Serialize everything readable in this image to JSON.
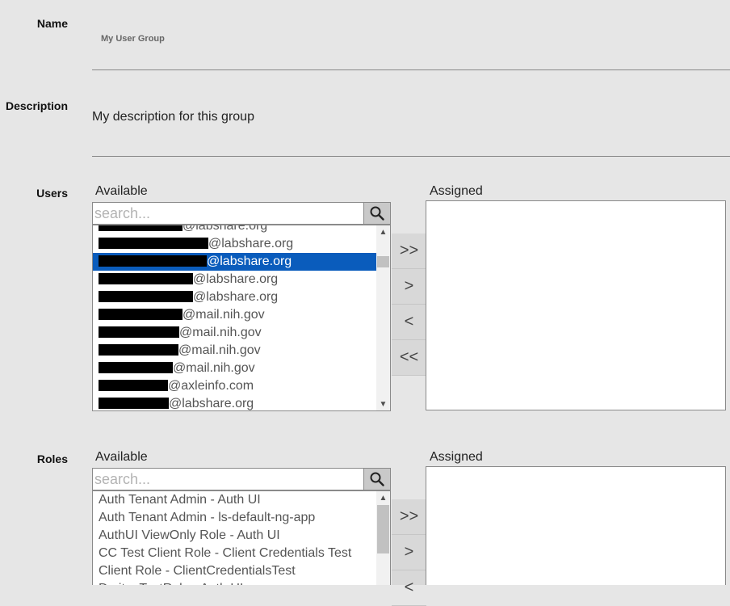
{
  "name": {
    "label": "Name",
    "value": "My User Group"
  },
  "description": {
    "label": "Description",
    "value": "My description for this group"
  },
  "users": {
    "label": "Users",
    "available_label": "Available",
    "assigned_label": "Assigned",
    "search_placeholder": "search...",
    "items": [
      {
        "suffix": "@labshare.org",
        "redact_width": 104,
        "selected": false
      },
      {
        "suffix": "@labshare.org",
        "redact_width": 136,
        "selected": false
      },
      {
        "suffix": "@labshare.org",
        "redact_width": 134,
        "selected": true
      },
      {
        "suffix": "@labshare.org",
        "redact_width": 117,
        "selected": false
      },
      {
        "suffix": "@labshare.org",
        "redact_width": 117,
        "selected": false
      },
      {
        "suffix": "@mail.nih.gov",
        "redact_width": 104,
        "selected": false
      },
      {
        "suffix": "@mail.nih.gov",
        "redact_width": 100,
        "selected": false
      },
      {
        "suffix": "@mail.nih.gov",
        "redact_width": 99,
        "selected": false
      },
      {
        "suffix": "@mail.nih.gov",
        "redact_width": 92,
        "selected": false
      },
      {
        "suffix": "@axleinfo.com",
        "redact_width": 86,
        "selected": false
      },
      {
        "suffix": "@labshare.org",
        "redact_width": 87,
        "selected": false
      }
    ],
    "buttons": {
      "add_all": ">>",
      "add": ">",
      "remove": "<",
      "remove_all": "<<"
    }
  },
  "roles": {
    "label": "Roles",
    "available_label": "Available",
    "assigned_label": "Assigned",
    "search_placeholder": "search...",
    "items": [
      "Auth Tenant Admin - Auth UI",
      "Auth Tenant Admin - ls-default-ng-app",
      "AuthUI ViewOnly Role - Auth UI",
      "CC Test Client Role - Client Credentials Test",
      "Client Role - ClientCredentialsTest",
      "Dmitry TestRole - Auth UI"
    ],
    "buttons": {
      "add_all": ">>",
      "add": ">",
      "remove": "<"
    }
  }
}
